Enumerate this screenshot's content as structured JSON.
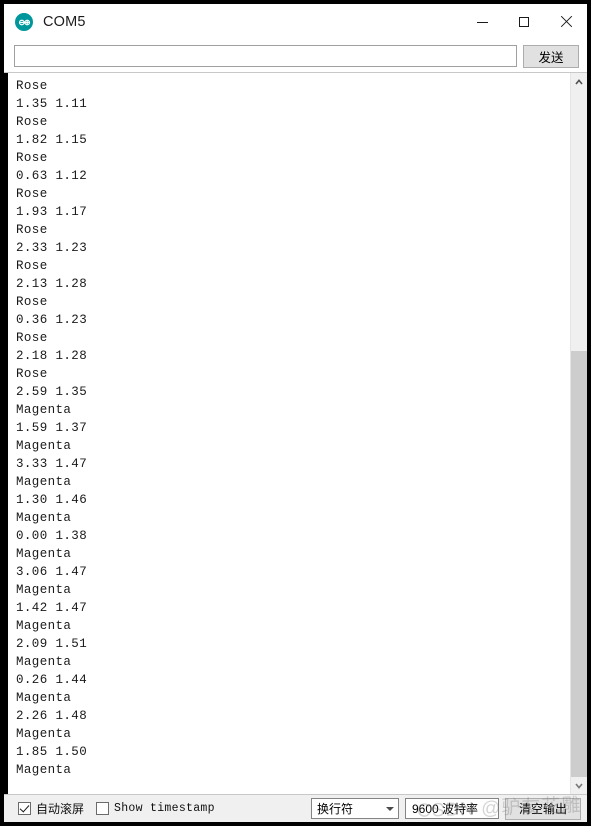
{
  "window": {
    "title": "COM5",
    "app_icon": "arduino-icon",
    "accent": "#00979c",
    "controls": {
      "minimize": "minimize-icon",
      "maximize": "maximize-icon",
      "close": "close-icon"
    }
  },
  "send_bar": {
    "input_value": "",
    "input_placeholder": "",
    "send_label": "发送"
  },
  "console": {
    "lines": [
      "Rose",
      "1.35 1.11",
      "Rose",
      "1.82 1.15",
      "Rose",
      "0.63 1.12",
      "Rose",
      "1.93 1.17",
      "Rose",
      "2.33 1.23",
      "Rose",
      "2.13 1.28",
      "Rose",
      "0.36 1.23",
      "Rose",
      "2.18 1.28",
      "Rose",
      "2.59 1.35",
      "Magenta",
      "1.59 1.37",
      "Magenta",
      "3.33 1.47",
      "Magenta",
      "1.30 1.46",
      "Magenta",
      "0.00 1.38",
      "Magenta",
      "3.06 1.47",
      "Magenta",
      "1.42 1.47",
      "Magenta",
      "2.09 1.51",
      "Magenta",
      "0.26 1.44",
      "Magenta",
      "2.26 1.48",
      "Magenta",
      "1.85 1.50",
      "Magenta"
    ]
  },
  "scrollbar": {
    "up_arrow": "chevron-up-icon",
    "down_arrow": "chevron-down-icon",
    "thumb_top_pct": 38,
    "thumb_height_pct": 62
  },
  "status_bar": {
    "autoscroll_label": "自动滚屏",
    "autoscroll_checked": true,
    "timestamp_label": "Show timestamp",
    "timestamp_checked": false,
    "line_ending_value": "换行符",
    "baud_value": "9600 波特率",
    "clear_label": "清空输出"
  },
  "watermark": {
    "text": "CSDN @驴友花雕"
  }
}
